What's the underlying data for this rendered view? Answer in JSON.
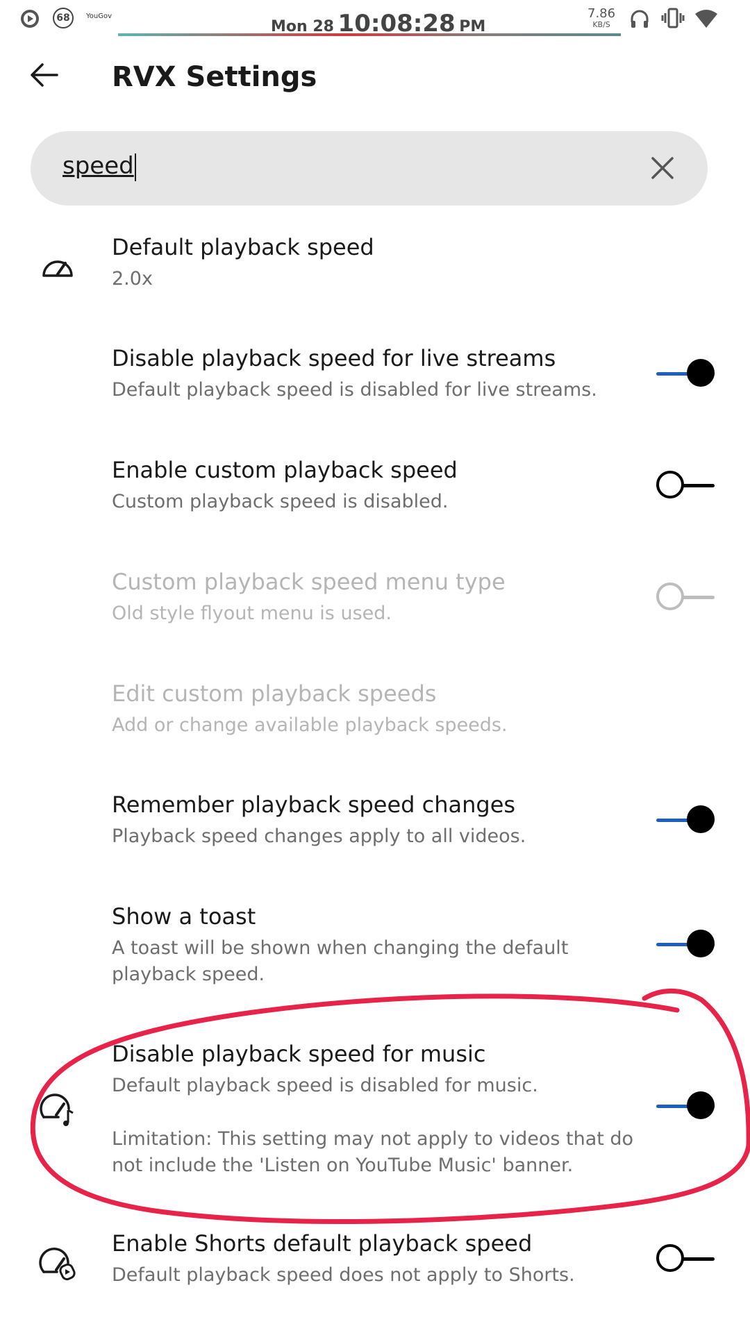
{
  "status_bar": {
    "badge_count": "68",
    "app_label": "YouGov",
    "date": "Mon 28",
    "time": "10:08:28",
    "ampm": "PM",
    "net_speed": "7.86",
    "net_unit": "KB/S"
  },
  "app_bar": {
    "title": "RVX Settings"
  },
  "search": {
    "value": "speed"
  },
  "settings": [
    {
      "title": "Default playback speed",
      "summary": "2.0x",
      "icon": "speed-icon"
    },
    {
      "title": "Disable playback speed for live streams",
      "summary": "Default playback speed is disabled for live streams.",
      "toggle": "on"
    },
    {
      "title": "Enable custom playback speed",
      "summary": "Custom playback speed is disabled.",
      "toggle": "off"
    },
    {
      "title": "Custom playback speed menu type",
      "summary": "Old style flyout menu is used.",
      "toggle": "disabled"
    },
    {
      "title": "Edit custom playback speeds",
      "summary": "Add or change available playback speeds.",
      "enabled": false
    },
    {
      "title": "Remember playback speed changes",
      "summary": "Playback speed changes apply to all videos.",
      "toggle": "on"
    },
    {
      "title": "Show a toast",
      "summary": "A toast will be shown when changing the default playback speed.",
      "toggle": "on"
    },
    {
      "title": "Disable playback speed for music",
      "summary": "Default playback speed is disabled for music.",
      "note": "Limitation: This setting may not apply to videos that do not include the 'Listen on YouTube Music' banner.",
      "toggle": "on",
      "icon": "speed-music-icon"
    },
    {
      "title": "Enable Shorts default playback speed",
      "summary": "Default playback speed does not apply to Shorts.",
      "toggle": "off",
      "icon": "speed-shorts-icon"
    }
  ],
  "annotation_color": "#e8234a"
}
